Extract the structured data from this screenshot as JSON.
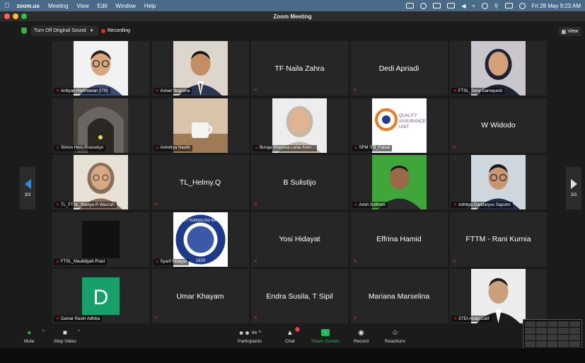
{
  "menubar": {
    "app": "zoom.us",
    "items": [
      "Meeting",
      "View",
      "Edit",
      "Window",
      "Help"
    ],
    "clock": "Fri 28 May  9:23 AM"
  },
  "window": {
    "title": "Zoom Meeting"
  },
  "topbar": {
    "original_sound": "Turn Off Original Sound",
    "recording": "Recording",
    "view": "View"
  },
  "pager": {
    "left": "3/3",
    "right": "3/3"
  },
  "tiles": [
    {
      "label": "Ardiyan Harimawan [ITB]",
      "center": "",
      "photo": "man-glasses"
    },
    {
      "label": "Ashari Nugraha",
      "center": "",
      "photo": "man-suit"
    },
    {
      "label": "",
      "center": "TF Naila Zahra",
      "photo": ""
    },
    {
      "label": "",
      "center": "Dedi Apriadi",
      "photo": ""
    },
    {
      "label": "FTSL_Seny Damayanti",
      "center": "",
      "photo": "woman-hijab-dark"
    },
    {
      "label": "Simon Heru Prassetyo",
      "center": "",
      "photo": "tunnel"
    },
    {
      "label": "Anindrya Nastiti",
      "center": "",
      "photo": "coffee"
    },
    {
      "label": "Bunga Kharissa Laras Kem...",
      "center": "",
      "photo": "woman-hijab"
    },
    {
      "label": "SPM ITB_Faisal",
      "center": "",
      "photo": "qa-logo"
    },
    {
      "label": "",
      "center": "W Widodo",
      "photo": ""
    },
    {
      "label": "TL_FTSL_Nadiya R Wasi'ah",
      "center": "",
      "photo": "woman-hijab-glasses"
    },
    {
      "label": "",
      "center": "TL_Helmy.Q",
      "photo": ""
    },
    {
      "label": "",
      "center": "B Sulistijo",
      "photo": ""
    },
    {
      "label": "Amin Sulthoni",
      "center": "",
      "photo": "man-green"
    },
    {
      "label": "Adhitya Gandaryus Saputro",
      "center": "",
      "photo": "man-office"
    },
    {
      "label": "FTSL_Maulidiyah Pravi",
      "center": "",
      "photo": "dark"
    },
    {
      "label": "Syarif Hidayat",
      "center": "",
      "photo": "itb-logo"
    },
    {
      "label": "",
      "center": "Yosi Hidayat",
      "photo": ""
    },
    {
      "label": "",
      "center": "Effrina Hamid",
      "photo": ""
    },
    {
      "label": "",
      "center": "FTTM - Rani Kurnia",
      "photo": ""
    },
    {
      "label": "Damar Rastri Adhika",
      "center": "",
      "photo": "avatar-d"
    },
    {
      "label": "",
      "center": "Umar Khayam",
      "photo": ""
    },
    {
      "label": "",
      "center": "Endra Susila, T Sipil",
      "photo": ""
    },
    {
      "label": "",
      "center": "Mariana Marselina",
      "photo": ""
    },
    {
      "label": "STEI-Abdul Latif",
      "center": "",
      "photo": "man-formal"
    }
  ],
  "logo_text": {
    "qa": [
      "QUALITY",
      "ASSURANCE",
      "UNIT"
    ],
    "itb": "INSTITUT TEKNOLOGI BANDUNG",
    "itb_year": "1920",
    "avatar_letter": "D"
  },
  "toolbar": {
    "mute": "Mute",
    "stop_video": "Stop Video",
    "participants": "Participants",
    "participants_count": "64",
    "chat": "Chat",
    "chat_badge": "1",
    "share": "Share Screen",
    "record": "Record",
    "reactions": "Reactions"
  },
  "colors": {
    "menubar": "#4a6a8a",
    "accent_blue": "#1f8ff0",
    "share_green": "#1db954",
    "recording_red": "#e02828",
    "tile_bg": "#262626"
  }
}
